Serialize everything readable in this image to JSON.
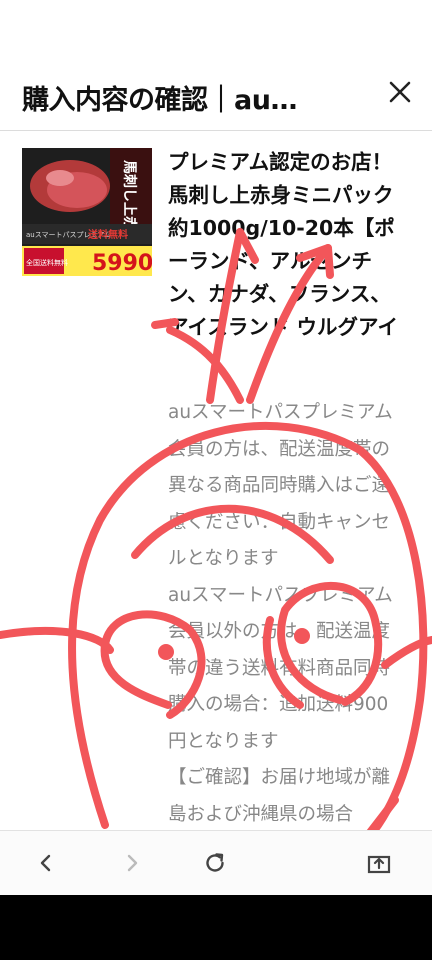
{
  "header": {
    "title": "購入内容の確認｜au…"
  },
  "product": {
    "name": "プレミアム認定のお店！馬刺し上赤身ミニパック約1000g/10-20本【ポーランド、アルゼンチン、カナダ、フランス、アイスランド ウルグアイ",
    "description": [
      "auスマートパスプレミアム会員の方は、配送温度帯の異なる商品同時購入はご遠慮ください：自動キャンセルとなります",
      "auスマートパスプレミアム会員以外の方は、配送温度帯の違う送料有料商品同時購入の場合：追加送料900円となります",
      "【ご確認】お届け地域が離島および沖縄県の場合"
    ],
    "image_texts": {
      "vertical": "馬刺し上赤身",
      "banner": "auスマートパスプレミアム",
      "shipping": "送料無料",
      "price": "5990",
      "badge": "全国送料無料"
    }
  },
  "icons": {
    "close": "close-icon",
    "back": "chevron-left-icon",
    "forward": "chevron-right-icon",
    "reload": "reload-icon",
    "share": "share-icon"
  },
  "colors": {
    "doodle": "#f2565a",
    "price": "#d4141b"
  }
}
